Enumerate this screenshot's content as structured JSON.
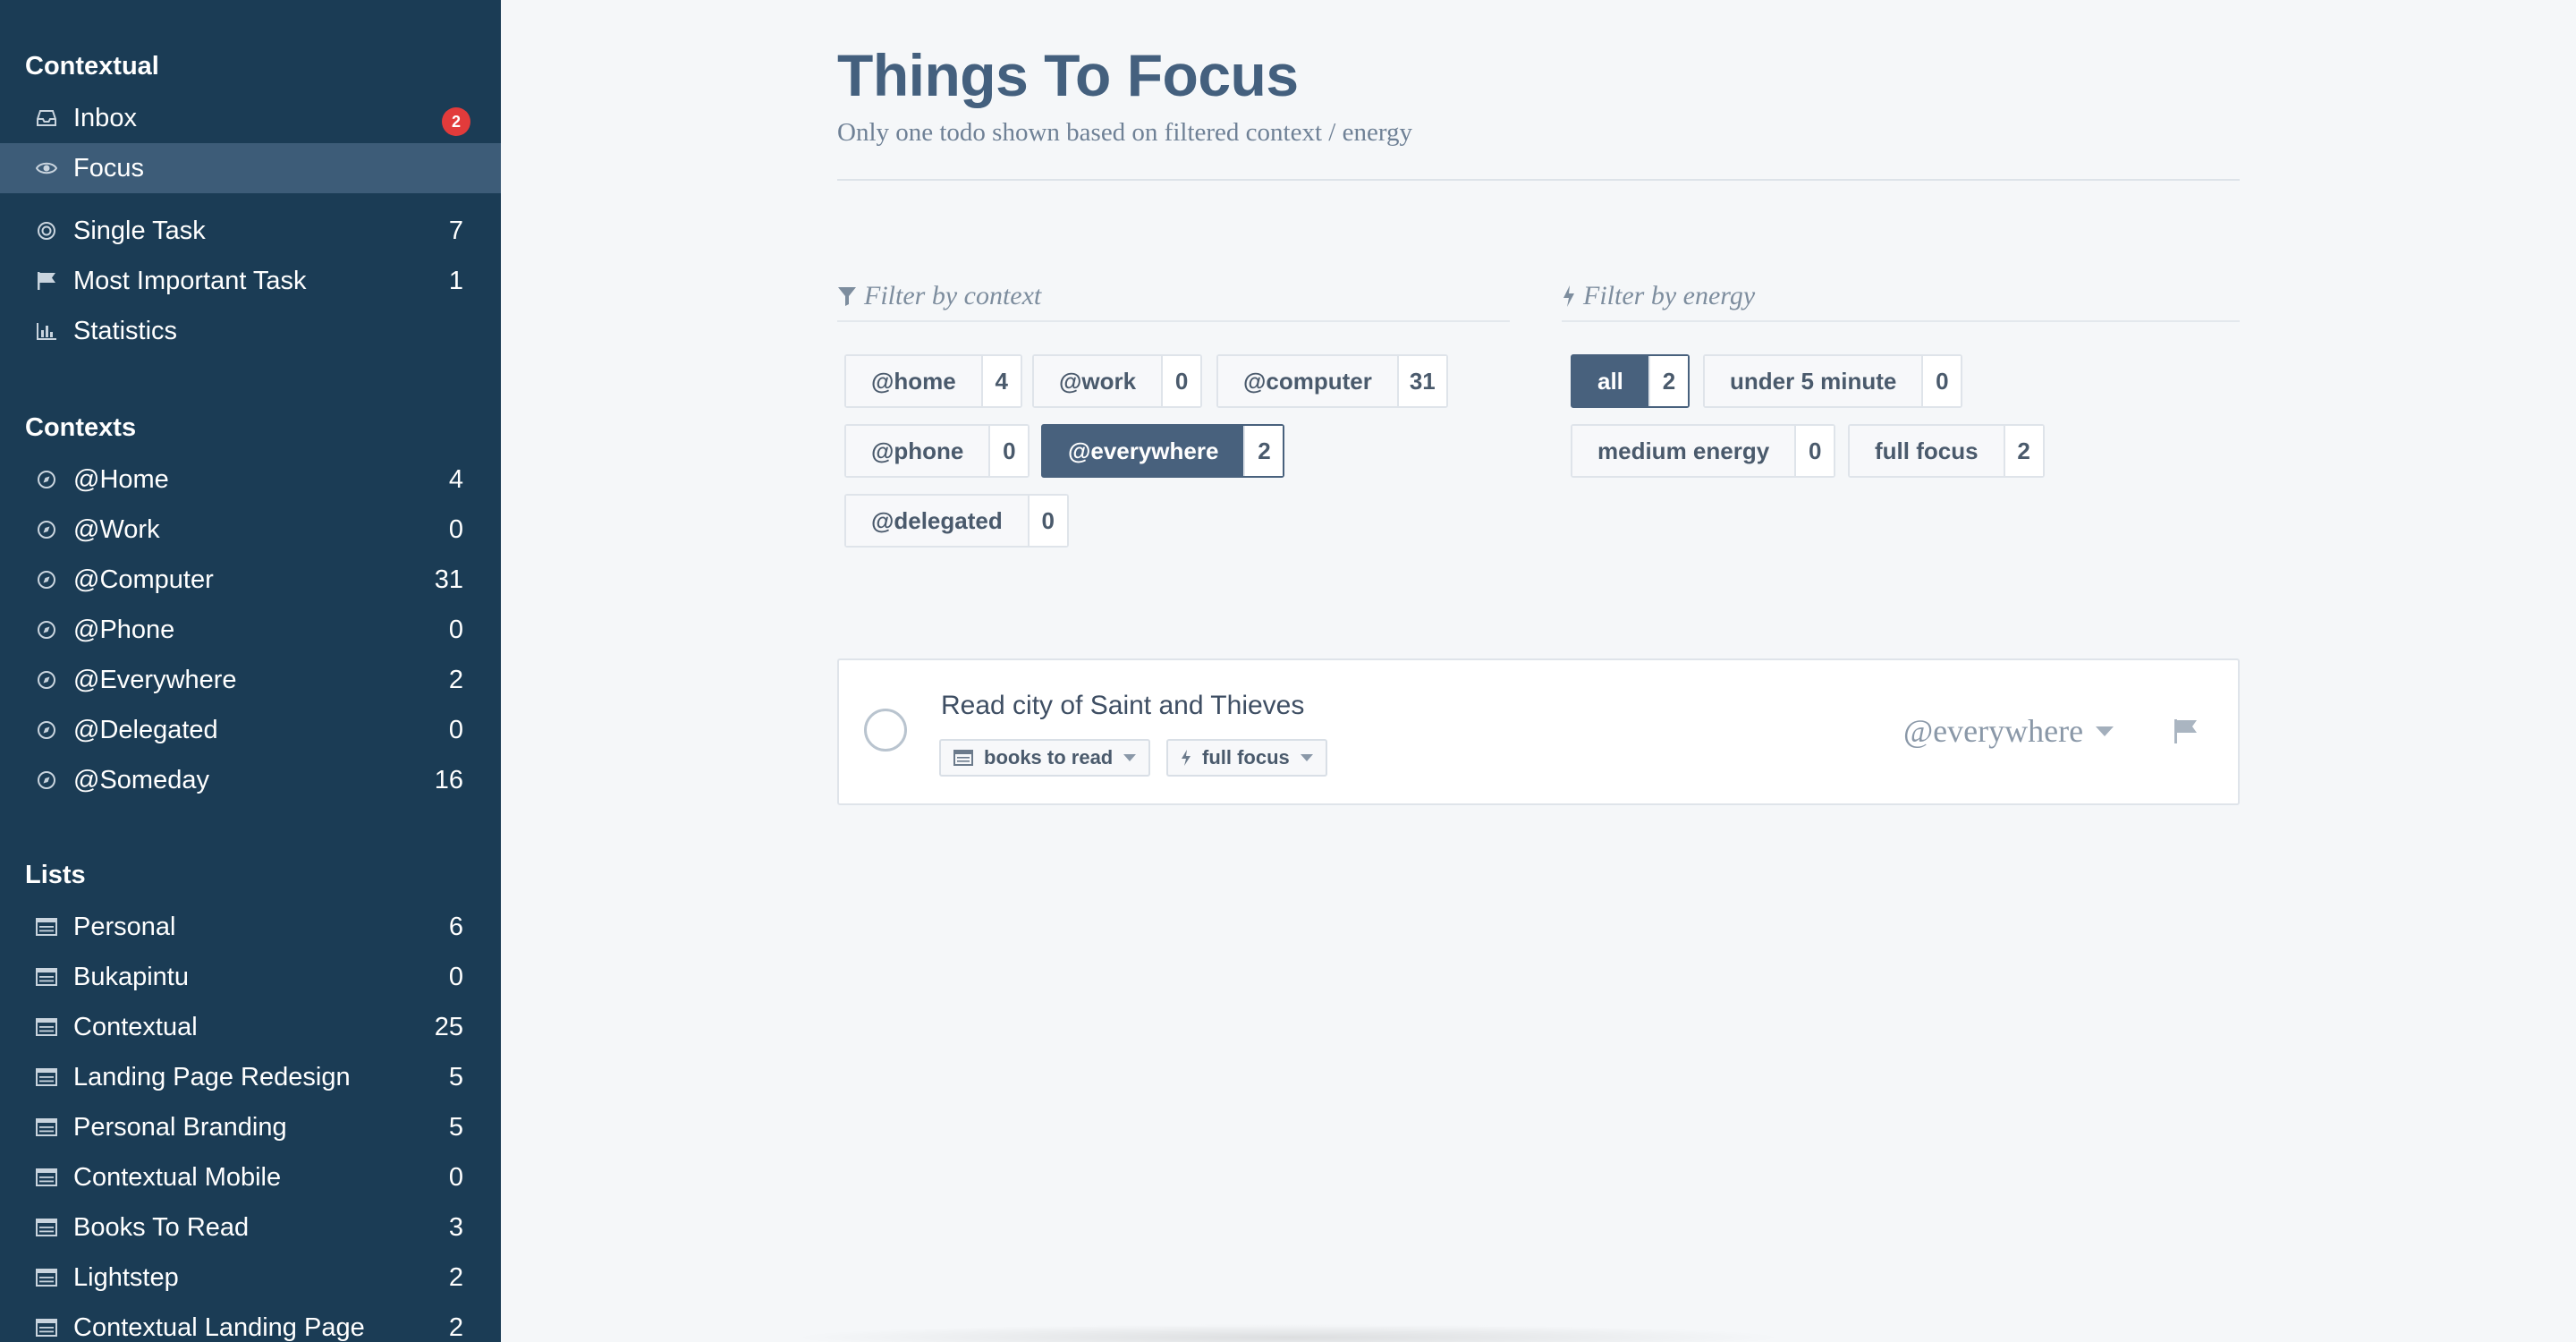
{
  "sidebar": {
    "contextual_heading": "Contextual",
    "inbox": {
      "label": "Inbox",
      "badge": "2",
      "icon": "inbox-icon"
    },
    "focus": {
      "label": "Focus",
      "icon": "eye-icon"
    },
    "single_task": {
      "label": "Single Task",
      "count": "7",
      "icon": "target-icon"
    },
    "most_important": {
      "label": "Most Important Task",
      "count": "1",
      "icon": "flag-icon"
    },
    "statistics": {
      "label": "Statistics",
      "icon": "bar-chart-icon"
    },
    "contexts_heading": "Contexts",
    "contexts": [
      {
        "label": "@Home",
        "count": "4"
      },
      {
        "label": "@Work",
        "count": "0"
      },
      {
        "label": "@Computer",
        "count": "31"
      },
      {
        "label": "@Phone",
        "count": "0"
      },
      {
        "label": "@Everywhere",
        "count": "2"
      },
      {
        "label": "@Delegated",
        "count": "0"
      },
      {
        "label": "@Someday",
        "count": "16"
      }
    ],
    "lists_heading": "Lists",
    "lists": [
      {
        "label": "Personal",
        "count": "6"
      },
      {
        "label": "Bukapintu",
        "count": "0"
      },
      {
        "label": "Contextual",
        "count": "25"
      },
      {
        "label": "Landing Page Redesign",
        "count": "5"
      },
      {
        "label": "Personal Branding",
        "count": "5"
      },
      {
        "label": "Contextual Mobile",
        "count": "0"
      },
      {
        "label": "Books To Read",
        "count": "3"
      },
      {
        "label": "Lightstep",
        "count": "2"
      },
      {
        "label": "Contextual Landing Page",
        "count": "2"
      }
    ]
  },
  "main": {
    "title": "Things To Focus",
    "subtitle": "Only one todo shown based on filtered context / energy",
    "filter_context": {
      "heading": "Filter by context",
      "options": [
        {
          "label": "@home",
          "count": "4",
          "selected": false
        },
        {
          "label": "@work",
          "count": "0",
          "selected": false
        },
        {
          "label": "@computer",
          "count": "31",
          "selected": false
        },
        {
          "label": "@phone",
          "count": "0",
          "selected": false
        },
        {
          "label": "@everywhere",
          "count": "2",
          "selected": true
        },
        {
          "label": "@delegated",
          "count": "0",
          "selected": false
        }
      ]
    },
    "filter_energy": {
      "heading": "Filter by energy",
      "options": [
        {
          "label": "all",
          "count": "2",
          "selected": true
        },
        {
          "label": "under 5 minute",
          "count": "0",
          "selected": false
        },
        {
          "label": "medium energy",
          "count": "0",
          "selected": false
        },
        {
          "label": "full focus",
          "count": "2",
          "selected": false
        }
      ]
    },
    "task": {
      "title": "Read city of Saint and Thieves",
      "list_tag": "books to read",
      "energy_tag": "full focus",
      "context": "@everywhere"
    }
  },
  "colors": {
    "sidebar_bg": "#1b3c55",
    "sidebar_active": "#3d5c78",
    "badge": "#e23b3b",
    "selected_pill": "#48617d",
    "page_bg": "#f5f7f9"
  }
}
